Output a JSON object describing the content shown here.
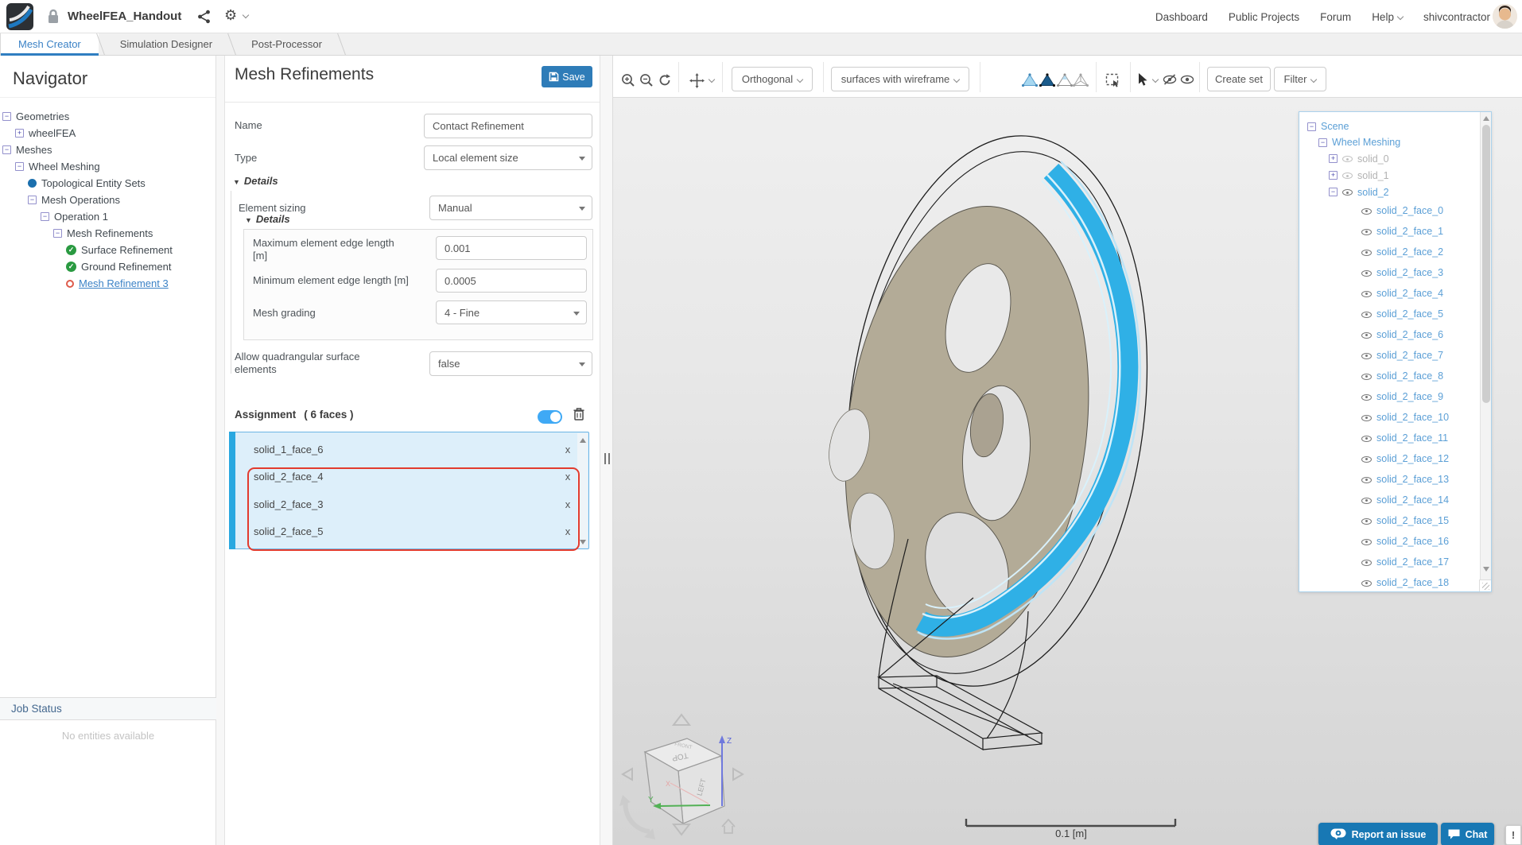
{
  "colors": {
    "accent": "#2e7cb8",
    "highlight_blue": "#2fb0e6",
    "annotation_red": "#e23b2e",
    "wheel_tan": "#b3ab97"
  },
  "header": {
    "project_title": "WheelFEA_Handout",
    "nav": [
      {
        "label": "Dashboard"
      },
      {
        "label": "Public Projects"
      },
      {
        "label": "Forum"
      },
      {
        "label": "Help",
        "caret": true
      }
    ],
    "username": "shivcontractor"
  },
  "tabs": [
    {
      "label": "Mesh Creator",
      "active": true
    },
    {
      "label": "Simulation Designer",
      "active": false
    },
    {
      "label": "Post-Processor",
      "active": false
    }
  ],
  "navigator": {
    "title": "Navigator",
    "tree": [
      {
        "icon": "minus",
        "label": "Geometries",
        "depth": 0
      },
      {
        "icon": "plus",
        "label": "wheelFEA",
        "depth": 1
      },
      {
        "icon": "minus",
        "label": "Meshes",
        "depth": 0
      },
      {
        "icon": "minus",
        "label": "Wheel Meshing",
        "depth": 1
      },
      {
        "icon": "dot",
        "label": "Topological Entity Sets",
        "depth": 2
      },
      {
        "icon": "minus",
        "label": "Mesh Operations",
        "depth": 2
      },
      {
        "icon": "minus",
        "label": "Operation 1",
        "depth": 3
      },
      {
        "icon": "minus",
        "label": "Mesh Refinements",
        "depth": 4
      },
      {
        "icon": "check",
        "label": "Surface Refinement",
        "depth": 5
      },
      {
        "icon": "check",
        "label": "Ground Refinement",
        "depth": 5
      },
      {
        "icon": "circle",
        "label": "Mesh Refinement 3",
        "depth": 5,
        "selected": true
      }
    ],
    "job_status": {
      "title": "Job Status",
      "empty_text": "No entities available"
    }
  },
  "settings": {
    "title": "Mesh Refinements",
    "save_label": "Save",
    "name_label": "Name",
    "name_value": "Contact Refinement",
    "type_label": "Type",
    "type_value": "Local element size",
    "details_label": "Details",
    "element_sizing_label": "Element sizing",
    "element_sizing_value": "Manual",
    "inner_details_label": "Details",
    "max_edge_label": "Maximum element edge length [m]",
    "max_edge_value": "0.001",
    "min_edge_label": "Minimum element edge length [m]",
    "min_edge_value": "0.0005",
    "mesh_grading_label": "Mesh grading",
    "mesh_grading_value": "4 - Fine",
    "quad_label": "Allow quadrangular surface elements",
    "quad_value": "false",
    "assignment": {
      "label": "Assignment",
      "count_label": "( 6 faces )",
      "remove_label": "x",
      "items": [
        "solid_1_face_6",
        "solid_2_face_4",
        "solid_2_face_3",
        "solid_2_face_5"
      ],
      "highlighted": [
        "solid_2_face_4",
        "solid_2_face_3",
        "solid_2_face_5"
      ]
    }
  },
  "viewport": {
    "toolbar": {
      "projection": "Orthogonal",
      "render_mode": "surfaces with wireframe",
      "create_set_label": "Create set",
      "filter_label": "Filter"
    },
    "scale_label": "0.1 [m]",
    "cube": {
      "top": "TOP",
      "left": "LEFT",
      "front": "FRONT",
      "x": "X",
      "y": "Y",
      "z": "Z"
    }
  },
  "scene_tree": {
    "root": "Scene",
    "group": "Wheel Meshing",
    "solids": [
      {
        "label": "solid_0",
        "expander": "plus",
        "dim": true
      },
      {
        "label": "solid_1",
        "expander": "plus",
        "dim": true
      },
      {
        "label": "solid_2",
        "expander": "minus",
        "dim": false
      }
    ],
    "faces": [
      "solid_2_face_0",
      "solid_2_face_1",
      "solid_2_face_2",
      "solid_2_face_3",
      "solid_2_face_4",
      "solid_2_face_5",
      "solid_2_face_6",
      "solid_2_face_7",
      "solid_2_face_8",
      "solid_2_face_9",
      "solid_2_face_10",
      "solid_2_face_11",
      "solid_2_face_12",
      "solid_2_face_13",
      "solid_2_face_14",
      "solid_2_face_15",
      "solid_2_face_16",
      "solid_2_face_17",
      "solid_2_face_18"
    ]
  },
  "footer": {
    "report_label": "Report an issue",
    "chat_label": "Chat",
    "alert_label": "!"
  }
}
